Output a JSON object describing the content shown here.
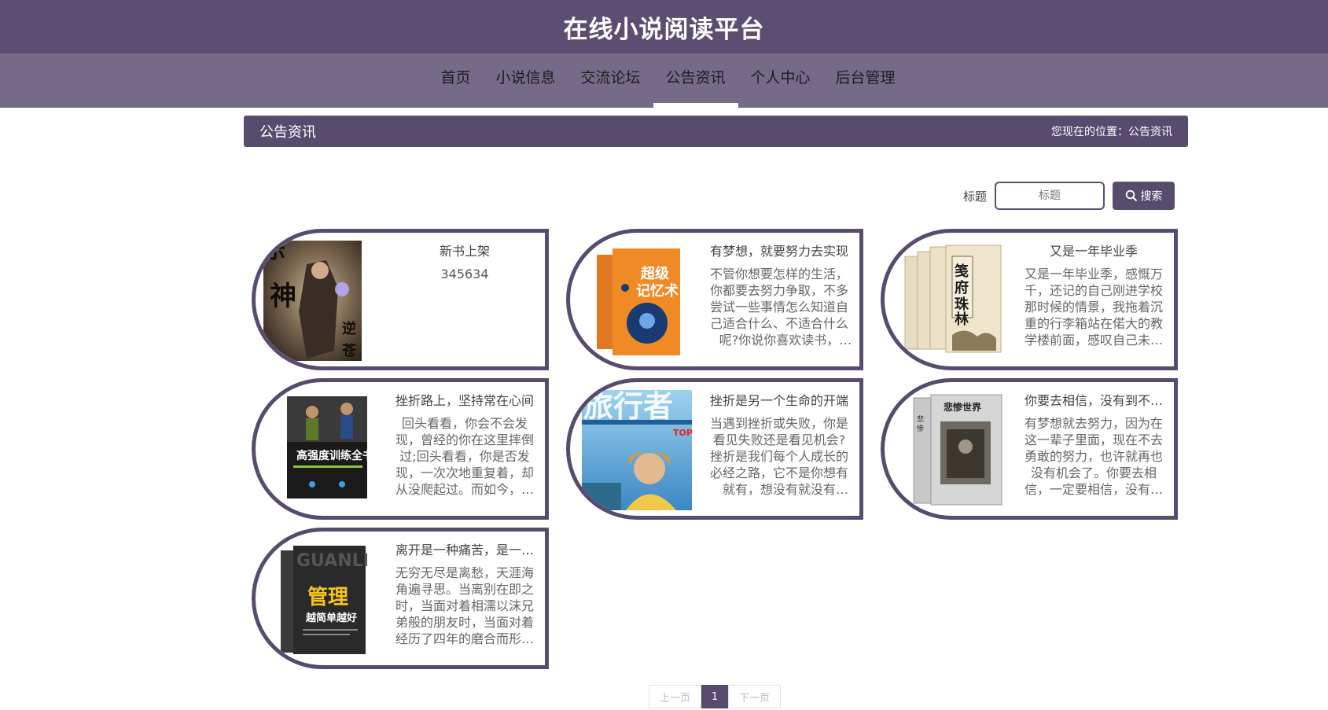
{
  "site": {
    "title": "在线小说阅读平台"
  },
  "nav": [
    {
      "label": "首页"
    },
    {
      "label": "小说信息"
    },
    {
      "label": "交流论坛"
    },
    {
      "label": "公告资讯",
      "active": true
    },
    {
      "label": "个人中心"
    },
    {
      "label": "后台管理"
    }
  ],
  "title_bar": {
    "label": "公告资讯",
    "location": "您现在的位置：公告资讯"
  },
  "search": {
    "label": "标题",
    "placeholder": "标题",
    "value": "",
    "button_label": "搜索"
  },
  "cards": [
    {
      "title": "新书上架",
      "body": "345634",
      "cover": "cover-fantasy-novel"
    },
    {
      "title": "有梦想，就要努力去实现",
      "body": "不管你想要怎样的生活，你都要去努力争取，不多尝试一些事情怎么知道自己适合什么、不适合什么呢?你说你喜欢读书，让…",
      "cover": "cover-memory-book"
    },
    {
      "title": "又是一年毕业季",
      "body": "又是一年毕业季，感慨万千，还记的自己刚进学校那时候的情景，我拖着沉重的行李箱站在偌大的教学楼前面，感叹自己未…",
      "cover": "cover-classic-books"
    },
    {
      "title": "挫折路上，坚持常在心间",
      "body": "回头看看，你会不会发现，曾经的你在这里摔倒过;回头看看，你是否发现，一次次地重复着，却从没爬起过。而如今，…",
      "cover": "cover-training-book"
    },
    {
      "title": "挫折是另一个生命的开端",
      "body": "当遇到挫折或失败，你是看见失败还是看见机会?挫折是我们每个人成长的必经之路，它不是你想有就有，想没有就没有的。…",
      "cover": "cover-travel-magazine"
    },
    {
      "title": "你要去相信，没有到不…",
      "body": "有梦想就去努力，因为在这一辈子里面，现在不去勇敢的努力，也许就再也没有机会了。你要去相信，一定要相信，没有…",
      "cover": "cover-les-miserables"
    },
    {
      "title": "离开是一种痛苦，是一…",
      "body": "无穷无尽是离愁，天涯海角遍寻思。当离别在即之时，当面对着相濡以沫兄弟般的朋友时，当面对着经历了四年的磨合而形…",
      "cover": "cover-management-book"
    }
  ],
  "pagination": {
    "prev": "上一页",
    "current": "1",
    "next": "下一页"
  },
  "colors": {
    "primary": "#574b6e",
    "nav_bg": "#756a88",
    "header_bg": "#5b4e72"
  }
}
